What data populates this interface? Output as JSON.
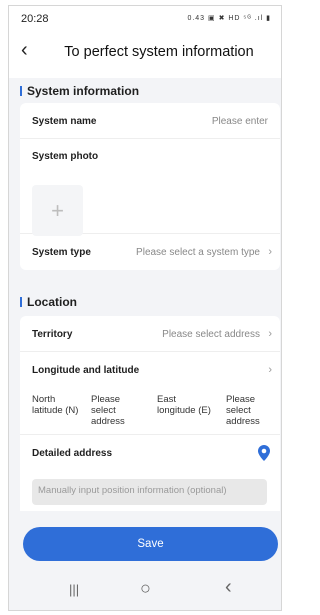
{
  "status_bar": {
    "time": "20:28",
    "icons": "0.43 ▣ ✖ HD ⁵ᴳ .ıl ▮"
  },
  "header": {
    "back_icon": "‹",
    "title": "To perfect system information"
  },
  "system_info": {
    "heading": "System information",
    "name_label": "System name",
    "name_placeholder": "Please enter",
    "photo_label": "System photo",
    "photo_add_icon": "+",
    "type_label": "System type",
    "type_placeholder": "Please select a system type"
  },
  "location": {
    "heading": "Location",
    "territory_label": "Territory",
    "territory_placeholder": "Please select address",
    "lonlat_label": "Longitude and latitude",
    "north_label": "North latitude (N)",
    "north_value": "Please select address",
    "east_label": "East longitude (E)",
    "east_value": "Please select address",
    "address_label": "Detailed address",
    "address_placeholder": "Manually input position information (optional)"
  },
  "chevron": "›",
  "save_label": "Save",
  "nav": {
    "recent": "|||",
    "home": "○",
    "back": "‹"
  },
  "colors": {
    "accent": "#2f6ed8",
    "background": "#f3f4f7"
  }
}
